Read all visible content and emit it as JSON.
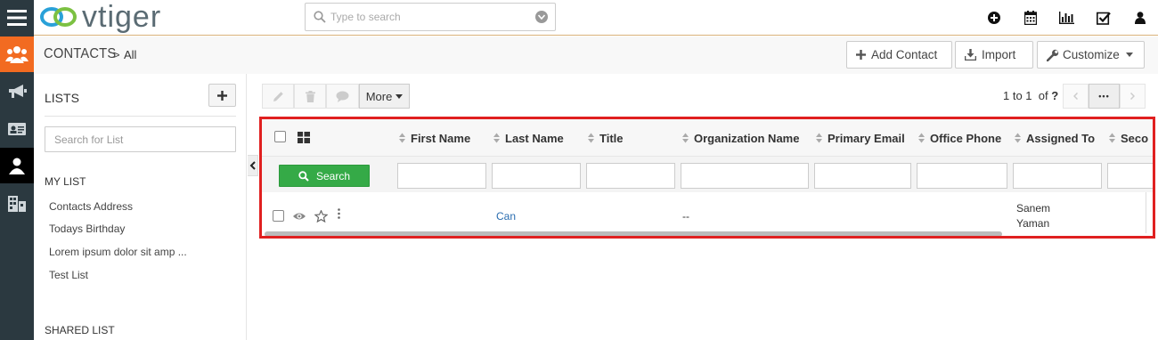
{
  "brand": {
    "name": "vtiger"
  },
  "global_search": {
    "placeholder": "Type to search"
  },
  "header": {
    "module": "CONTACTS",
    "separator": ">",
    "view": "All",
    "buttons": {
      "add_contact": "Add Contact",
      "import": "Import",
      "customize": "Customize"
    }
  },
  "lists": {
    "title": "LISTS",
    "search_placeholder": "Search for List",
    "my_list_title": "MY LIST",
    "my_list": [
      "Contacts Address",
      "Todays Birthday",
      "Lorem ipsum dolor sit amp ...",
      "Test List"
    ],
    "shared_list_title": "SHARED LIST"
  },
  "toolbar": {
    "more_label": "More"
  },
  "pagination": {
    "range": "1 to 1",
    "of_label": "of",
    "total": "?",
    "dots": "•••"
  },
  "table": {
    "columns": [
      "First Name",
      "Last Name",
      "Title",
      "Organization Name",
      "Primary Email",
      "Office Phone",
      "Assigned To",
      "Seco"
    ],
    "search_label": "Search",
    "rows": [
      {
        "first_name": "",
        "last_name": "Can",
        "title": "",
        "organization": "--",
        "email": "",
        "phone": "",
        "assigned_to_line1": "Sanem",
        "assigned_to_line2": "Yaman"
      }
    ]
  },
  "colors": {
    "accent_orange": "#f26b21",
    "rail_dark": "#2b3940",
    "highlight_red": "#e02020",
    "search_green": "#35aa47",
    "link_blue": "#2a6db0"
  },
  "icons": {
    "rail": [
      "menu-icon",
      "contacts-module-icon",
      "megaphone-icon",
      "contact-card-icon",
      "person-icon",
      "organization-icon"
    ],
    "top": [
      "plus-circle-icon",
      "calendar-icon",
      "bar-chart-icon",
      "checkbox-icon",
      "user-icon"
    ]
  }
}
